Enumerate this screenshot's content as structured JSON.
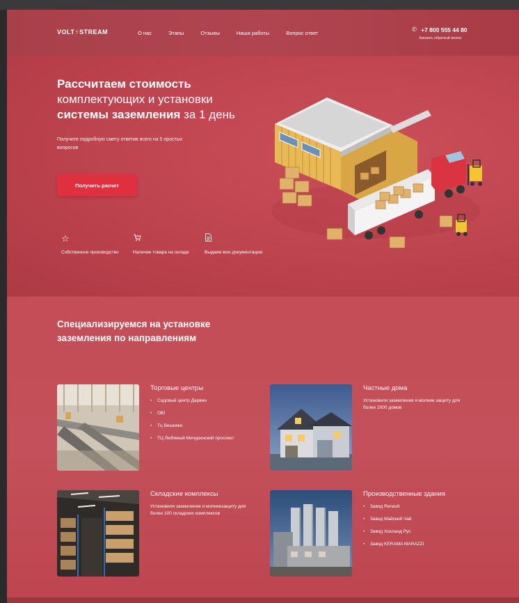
{
  "header": {
    "logo_volt": "VOLT",
    "logo_stream": "STREAM",
    "nav": [
      "О нас",
      "Этапы",
      "Отзывы",
      "Наши работы",
      "Вопрос ответ"
    ],
    "phone": "+7 800 555 44 80",
    "callback": "Заказать обратный звонок"
  },
  "hero": {
    "title_l1_bold": "Рассчитаем стоимость",
    "title_l2": "комплектующих и установки",
    "title_l3_bold": "системы заземления",
    "title_l3_rest": " за 1 день",
    "subtitle": "Получите подробную смету ответив всего на 5 простых вопросов",
    "cta": "Получить расчет",
    "features": [
      {
        "icon": "star-icon",
        "glyph": "☆",
        "text": "Собственное производство"
      },
      {
        "icon": "cart-icon",
        "glyph": "⛟",
        "text": "Наличие товара на складе"
      },
      {
        "icon": "document-icon",
        "glyph": "🗎",
        "text": "Выдаем всю документацию"
      }
    ]
  },
  "spec": {
    "title": "Специализируемся на установке заземления по направлениям",
    "cards": [
      {
        "title": "Торговые центры",
        "items": [
          "Садовый центр Дарвин",
          "OBI",
          "Тц Вешняки",
          "ТЦ Любимый Мичуринский проспект"
        ]
      },
      {
        "title": "Частные дома",
        "text": "Установили заземления и молние защиту для более 2000 домов"
      },
      {
        "title": "Складские комплексы",
        "text": "Установили заземление и молниезащиту для более 100 складских комплексов"
      },
      {
        "title": "Производственные здания",
        "items": [
          "Завод Renault",
          "Завод Майский Чай",
          "Завод Хохланд Рус",
          "Завод KERAMA MARAZZI"
        ]
      }
    ]
  },
  "colors": {
    "accent": "#e0303f",
    "background": "#c04652",
    "logo_bolt": "#f2d24a"
  }
}
